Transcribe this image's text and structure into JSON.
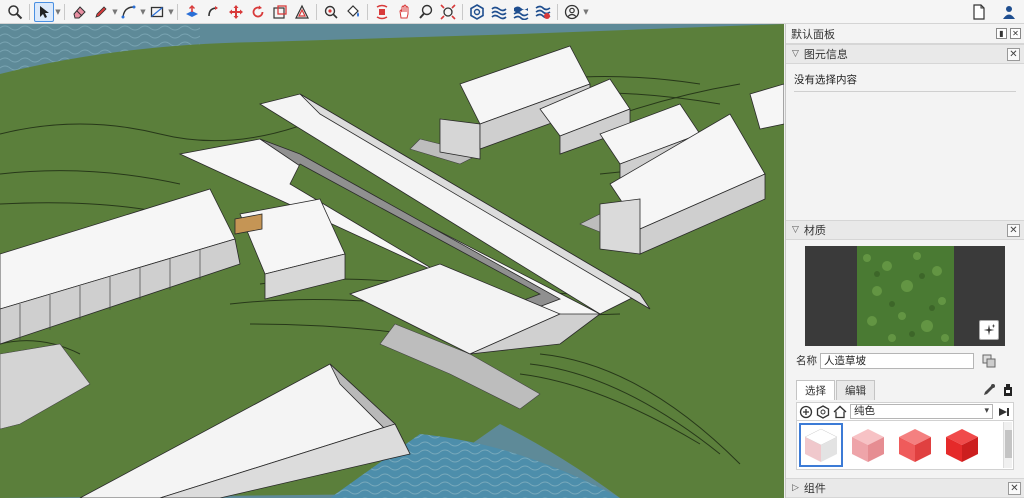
{
  "panel": {
    "title": "默认面板",
    "entity_info": {
      "title": "图元信息",
      "empty_text": "没有选择内容"
    },
    "materials": {
      "title": "材质",
      "name_label": "名称",
      "name_value": "人造草坡",
      "tabs": [
        {
          "label": "选择",
          "selected": true
        },
        {
          "label": "编辑",
          "selected": false
        }
      ],
      "library": "纯色",
      "swatches": [
        "#fafafa",
        "#f2a9ac",
        "#ef5b5b",
        "#e52a2a"
      ]
    },
    "components": {
      "title": "组件"
    }
  },
  "colors": {
    "accent": "#3c7bd6",
    "grass": "#5b7f3b",
    "water": "#5e8a98"
  }
}
